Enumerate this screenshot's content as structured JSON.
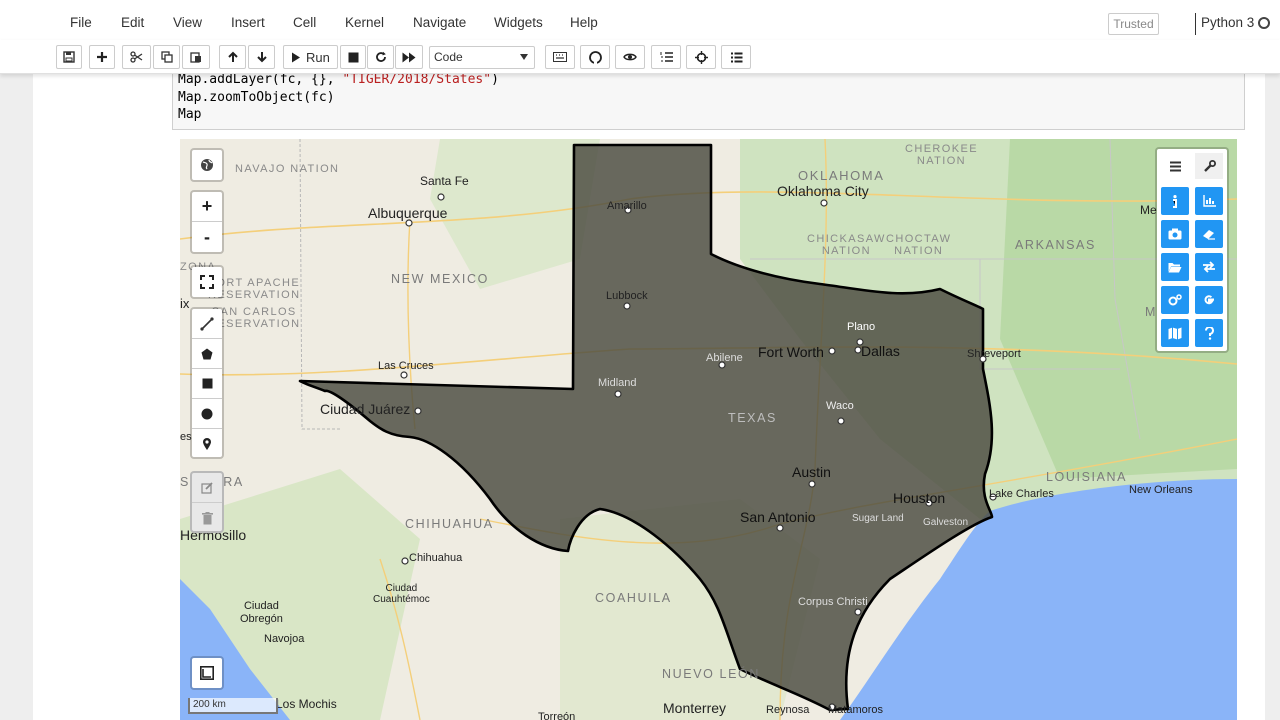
{
  "menubar": {
    "items": [
      "File",
      "Edit",
      "View",
      "Insert",
      "Cell",
      "Kernel",
      "Navigate",
      "Widgets",
      "Help"
    ],
    "trusted": "Trusted",
    "kernel": "Python 3"
  },
  "toolbar": {
    "run_label": "Run",
    "cell_type": "Code"
  },
  "code": {
    "line1_a": "Map.addLayer(fc, {}, ",
    "line1_str": "\"TIGER/2018/States\"",
    "line1_b": ")",
    "line2": "Map.zoomToObject(fc)",
    "line3": "Map"
  },
  "map": {
    "zoom_in": "+",
    "zoom_out": "-",
    "scale": "200 km",
    "highlight_color": "#4a4a40",
    "cities": {
      "santa_fe": "Santa Fe",
      "albuquerque": "Albuquerque",
      "amarillo": "Amarillo",
      "oklahoma_city": "Oklahoma City",
      "lubbock": "Lubbock",
      "plano": "Plano",
      "fort_worth": "Fort Worth",
      "dallas": "Dallas",
      "shreveport": "Shreveport",
      "abilene": "Abilene",
      "las_cruces": "Las Cruces",
      "midland": "Midland",
      "ciudad_juarez": "Ciudad Juárez",
      "waco": "Waco",
      "austin": "Austin",
      "houston": "Houston",
      "lake_charles": "Lake Charles",
      "new_orleans": "New Orleans",
      "san_antonio": "San Antonio",
      "sugar_land": "Sugar Land",
      "galveston": "Galveston",
      "hermosillo": "Hermosillo",
      "chihuahua": "Chihuahua",
      "ciudad_cuauhtemoc": "Ciudad\nCuauhtémoc",
      "ciudad_obregon": "Ciudad\nObregón",
      "navojoa": "Navojoa",
      "corpus_christi": "Corpus Christi",
      "los_mochis": "Los Mochis",
      "monterrey": "Monterrey",
      "reynosa": "Reynosa",
      "matamoros": "Matamoros",
      "torreon": "Torreón",
      "me": "Me",
      "ix": "ix",
      "es": "es"
    },
    "regions": {
      "navajo": "NAVAJO NATION",
      "oklahoma": "OKLAHOMA",
      "cherokee": "CHEROKEE\nNATION",
      "new_mexico": "NEW MEXICO",
      "arkansas": "ARKANSAS",
      "chickasaw": "CHICKASAW\nNATION",
      "choctaw": "CHOCTAW\nNATION",
      "fort_apache": "FORT APACHE\nRESERVATION",
      "san_carlos": "SAN CARLOS\nRESERVATION",
      "texas": "TEXAS",
      "louisiana": "LOUISIANA",
      "sonora": "SONORA",
      "chihuahua": "CHIHUAHUA",
      "coahuila": "COAHUILA",
      "nuevo_leon": "NUEVO LEÓN",
      "mi": "MI",
      "zona": "ZONA"
    }
  }
}
